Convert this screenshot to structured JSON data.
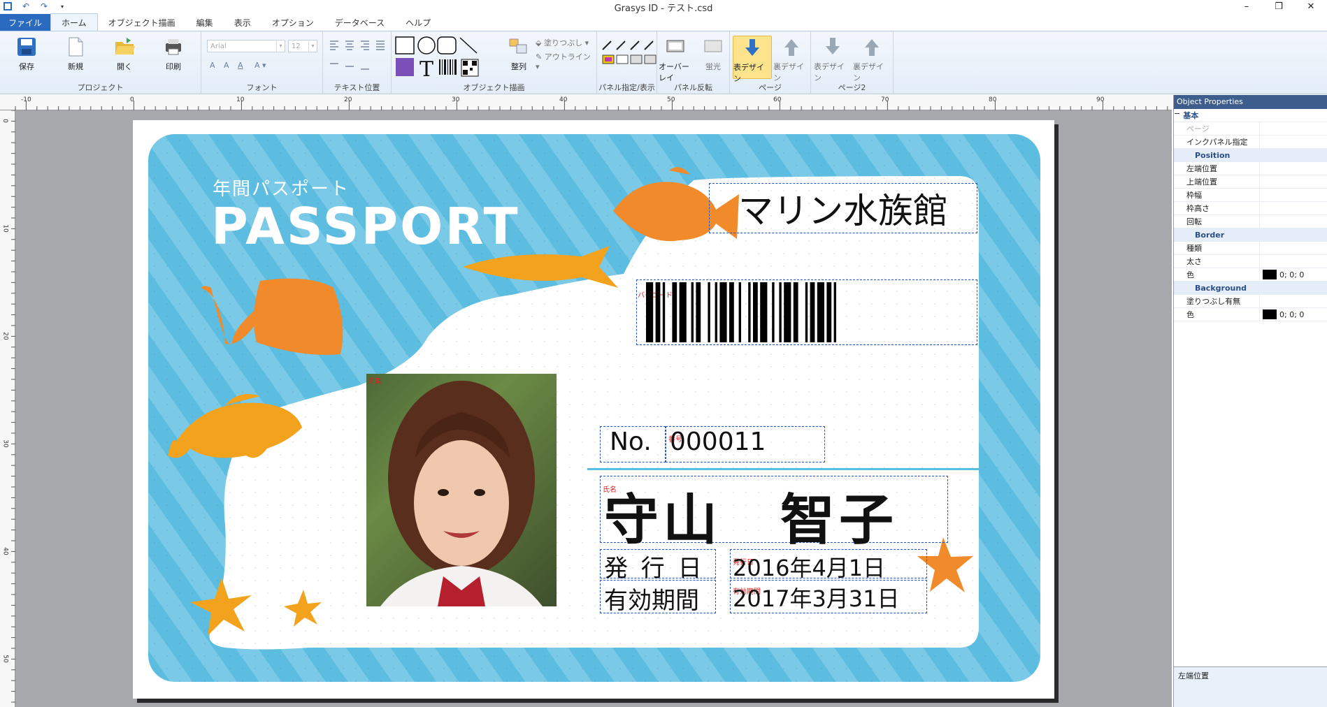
{
  "window": {
    "title": "Grasys ID - テスト.csd"
  },
  "tabs": [
    "ファイル",
    "ホーム",
    "オブジェクト描画",
    "編集",
    "表示",
    "オプション",
    "データベース",
    "ヘルプ"
  ],
  "ribbon": {
    "project": {
      "label": "プロジェクト",
      "save": "保存",
      "new": "新規",
      "open": "開く",
      "print": "印刷"
    },
    "font": {
      "label": "フォント",
      "family": "Arial",
      "size": "12"
    },
    "text_pos": {
      "label": "テキスト位置"
    },
    "object_draw": {
      "label": "オブジェクト描画",
      "fill": "塗りつぶし",
      "outline": "アウトライン",
      "align": "整列"
    },
    "panel": {
      "label": "パネル指定/表示",
      "overlay": "オーバーレイ",
      "fluor": "蛍光",
      "panel_flip": "パネル反転"
    },
    "page": {
      "label": "ページ",
      "front": "表デザイン",
      "back": "裏デザイン"
    },
    "page2": {
      "label": "ページ2",
      "front": "表デザイン",
      "back": "裏デザイン"
    }
  },
  "ruler": {
    "h": [
      "-10",
      "0",
      "10",
      "20",
      "30",
      "40",
      "50",
      "60",
      "70",
      "80",
      "90"
    ],
    "v": [
      "0",
      "10",
      "20",
      "30",
      "40",
      "50"
    ]
  },
  "card": {
    "subtitle": "年間パスポート",
    "title": "PASSPORT",
    "venue": "マリン水族館",
    "barcode_tag": "バーコード",
    "photo_tag": "写真",
    "no_label": "No.",
    "number": "000011",
    "number_tag": "番号",
    "name": "守山　智子",
    "name_tag": "氏名",
    "issue_label": "発 行 日",
    "issue_date": "2016年4月1日",
    "issue_tag": "発行日",
    "valid_label": "有効期間",
    "valid_date": "2017年3月31日",
    "valid_tag": "有効期間",
    "colors": {
      "card_blue": "#5dbde0",
      "orange": "#f08a2a",
      "yellow_orange": "#f3a21d"
    }
  },
  "properties": {
    "header": "Object Properties",
    "rows": [
      {
        "type": "cat",
        "key": "基本"
      },
      {
        "type": "dim",
        "key": "ページ"
      },
      {
        "type": "row",
        "key": "インクパネル指定"
      },
      {
        "type": "sub",
        "key": "Position"
      },
      {
        "type": "row",
        "key": "左端位置"
      },
      {
        "type": "row",
        "key": "上端位置"
      },
      {
        "type": "row",
        "key": "枠幅"
      },
      {
        "type": "row",
        "key": "枠高さ"
      },
      {
        "type": "row",
        "key": "回転"
      },
      {
        "type": "sub",
        "key": "Border"
      },
      {
        "type": "row",
        "key": "種類"
      },
      {
        "type": "row",
        "key": "太さ"
      },
      {
        "type": "color",
        "key": "色",
        "value": "0; 0; 0"
      },
      {
        "type": "sub",
        "key": "Background"
      },
      {
        "type": "row",
        "key": "塗りつぶし有無"
      },
      {
        "type": "color",
        "key": "色",
        "value": "0; 0; 0"
      }
    ],
    "description": "左端位置"
  }
}
